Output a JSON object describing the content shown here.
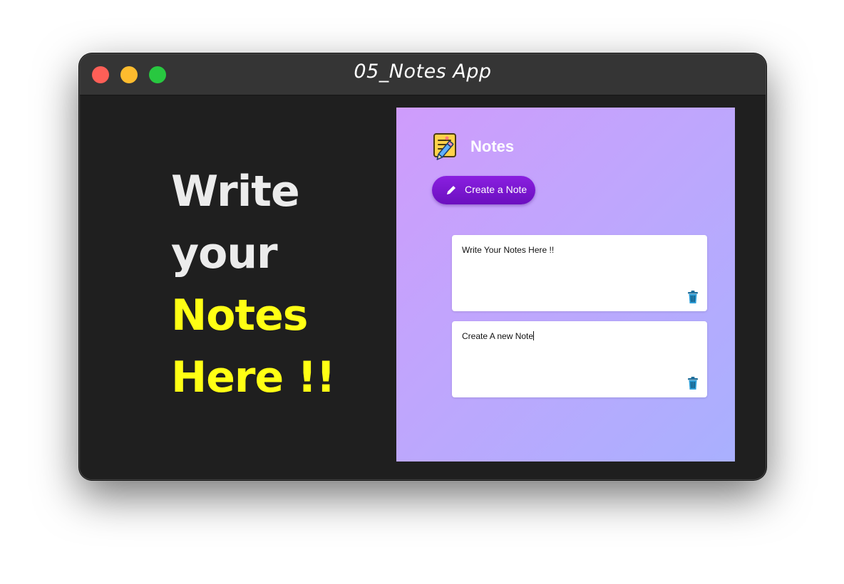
{
  "window": {
    "title": "05_Notes App"
  },
  "headline": {
    "line1": "Write",
    "line2": "your",
    "line3": "Notes",
    "line4": "Here !!"
  },
  "app": {
    "title": "Notes",
    "create_button_label": "Create a Note",
    "notes": [
      {
        "text": "Write Your Notes Here !!"
      },
      {
        "text": "Create A new Note"
      }
    ]
  },
  "colors": {
    "accent": "#7a16d2",
    "highlight": "#ffff14",
    "gradient_start": "#cf9cfc",
    "gradient_end": "#a9b0fe"
  },
  "icons": {
    "logo": "sticky-note-pencil-icon",
    "create": "pencil-icon",
    "delete": "trash-icon"
  }
}
